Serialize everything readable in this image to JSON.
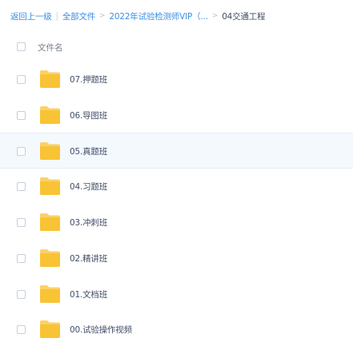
{
  "breadcrumb": {
    "back": "返回上一级",
    "all_files": "全部文件",
    "level1": "2022年试验检测师VIP（...",
    "current": "04交通工程"
  },
  "list": {
    "header_label": "文件名",
    "folder_color": "#f9c336",
    "items": [
      {
        "name": "07.押题班"
      },
      {
        "name": "06.导图班"
      },
      {
        "name": "05.真题班"
      },
      {
        "name": "04.习题班"
      },
      {
        "name": "03.冲刺班"
      },
      {
        "name": "02.精讲班"
      },
      {
        "name": "01.文档班"
      },
      {
        "name": "00.试验操作视频"
      }
    ]
  }
}
